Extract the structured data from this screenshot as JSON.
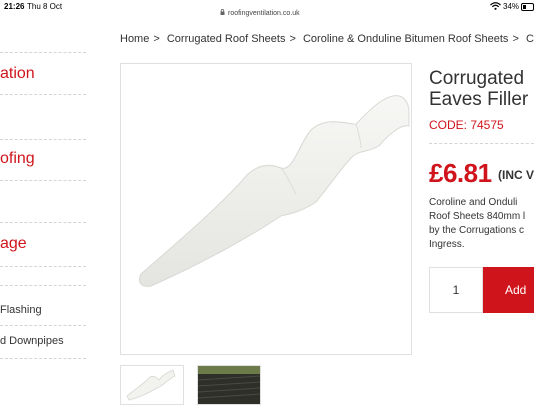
{
  "status_bar": {
    "time": "21:26",
    "date": "Thu 8 Oct",
    "url": "roofingventilation.co.uk",
    "battery": "34%",
    "battery_level": 0.34
  },
  "sidebar": {
    "categories": [
      "ation",
      "ofing",
      "age"
    ],
    "subitems": [
      "Flashing",
      "d Downpipes"
    ]
  },
  "breadcrumb": [
    "Home",
    "Corrugated Roof Sheets",
    "Coroline & Onduline Bitumen Roof Sheets",
    "Corru"
  ],
  "breadcrumb_separator": ">",
  "product": {
    "title_line1": "Corrugated",
    "title_line2": "Eaves Filler",
    "code": "CODE: 74575",
    "price": "£6.81",
    "price_note": "(INC V",
    "description": [
      "Coroline and Onduli",
      "Roof Sheets 840mm l",
      "by the Corrugations c",
      "Ingress."
    ],
    "quantity": "1",
    "add_label": "Add"
  },
  "colors": {
    "accent": "#d0141c",
    "text": "#333333",
    "border": "#e0e0e0"
  }
}
